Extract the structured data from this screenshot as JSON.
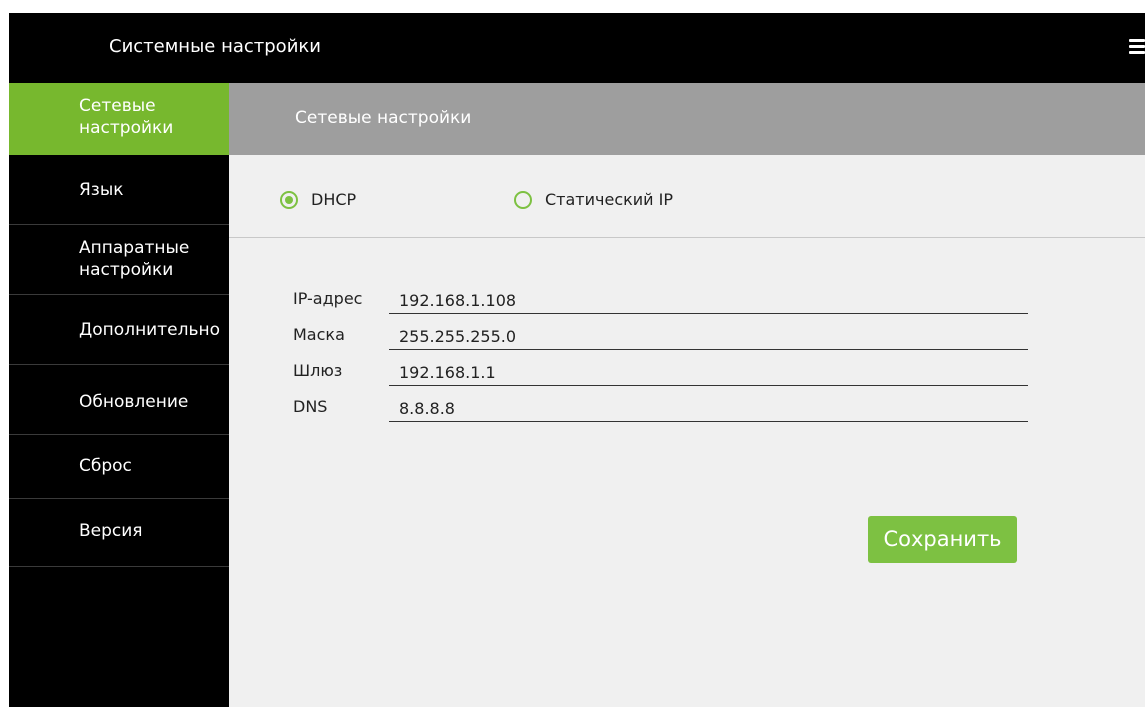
{
  "header": {
    "title": "Системные настройки",
    "menu_icon": "hamburger-menu-icon"
  },
  "sidebar": {
    "items": [
      {
        "label": "Сетевые\nнастройки",
        "active": true
      },
      {
        "label": "Язык",
        "active": false
      },
      {
        "label": "Аппаратные\nнастройки",
        "active": false
      },
      {
        "label": "Дополнительно",
        "active": false
      },
      {
        "label": "Обновление",
        "active": false
      },
      {
        "label": "Сброс",
        "active": false
      },
      {
        "label": "Версия",
        "active": false
      }
    ]
  },
  "main": {
    "title": "Сетевые настройки",
    "network_mode": {
      "options": [
        {
          "label": "DHCP",
          "selected": true
        },
        {
          "label": "Статический IP",
          "selected": false
        }
      ]
    },
    "fields": [
      {
        "label": "IP-адрес",
        "value": "192.168.1.108"
      },
      {
        "label": "Маска",
        "value": "255.255.255.0"
      },
      {
        "label": "Шлюз",
        "value": "192.168.1.1"
      },
      {
        "label": "DNS",
        "value": "8.8.8.8"
      }
    ],
    "save_label": "Сохранить"
  },
  "colors": {
    "accent": "#7dc142",
    "active_nav": "#77b82e",
    "header_bg": "#000000",
    "section_header_bg": "#9e9e9e",
    "content_bg": "#f0f0f0"
  }
}
